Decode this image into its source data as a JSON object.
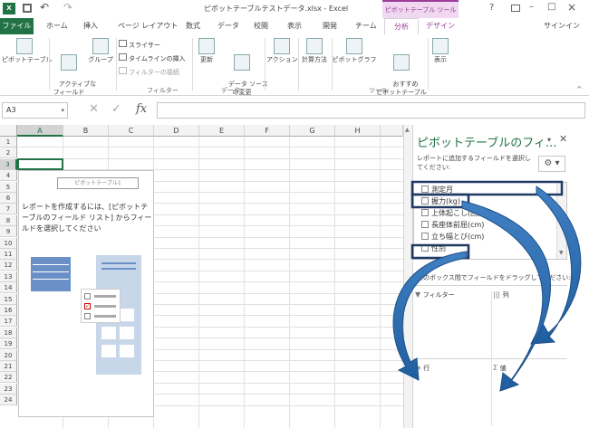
{
  "title": "ピボットテーブルテストデータ.xlsx - Excel",
  "context_tab": "ピボットテーブル ツール",
  "window_controls": {
    "help": "?",
    "minimize": "–",
    "restore": "□",
    "close": "×"
  },
  "signin": "サインイン",
  "tabs": [
    "ファイル",
    "ホーム",
    "挿入",
    "ページ レイアウト",
    "数式",
    "データ",
    "校閲",
    "表示",
    "開発",
    "チーム",
    "分析",
    "デザイン"
  ],
  "ribbon": {
    "pivot_table": "ピボットテーブル",
    "active_field": "アクティブな\nフィールド",
    "group": "グループ",
    "slicer": "スライサー",
    "timeline": "タイムラインの挿入",
    "filter_conn": "フィルターの接続",
    "filter_group": "フィルター",
    "refresh": "更新",
    "change_source": "データ ソース\nの変更",
    "data_group": "データ",
    "actions": "アクション",
    "calc": "計算方法",
    "pivot_chart": "ピボットグラフ",
    "recommended": "おすすめ\nピボットテーブル",
    "tools_group": "ツール",
    "show": "表示"
  },
  "namebox": "A3",
  "fx": "fx",
  "columns": [
    "A",
    "B",
    "C",
    "D",
    "E",
    "F",
    "G",
    "H"
  ],
  "rows": [
    "1",
    "2",
    "3",
    "4",
    "5",
    "6",
    "7",
    "8",
    "9",
    "10",
    "11",
    "12",
    "13",
    "14",
    "15",
    "16",
    "17",
    "18",
    "19",
    "20",
    "21",
    "22",
    "23",
    "24"
  ],
  "pivot_placeholder": {
    "label": "ピボットテーブル1",
    "instruction": "レポートを作成するには、[ピボットテーブルのフィールド リスト] からフィールドを選択してください"
  },
  "pane": {
    "title": "ピボットテーブルのフィ...",
    "subtitle": "レポートに追加するフィールドを選択してください:",
    "fields": [
      "測定月",
      "握力(kg)",
      "上体起こし(回)",
      "長座体前屈(cm)",
      "立ち幅とび(cm)",
      "性別"
    ],
    "drag_hint": "次のボックス間でフィールドをドラッグしてください:",
    "filter": "フィルター",
    "columns": "列",
    "rows": "行",
    "values": "値"
  },
  "colors": {
    "excel_green": "#217346",
    "context_purple": "#9a3d9a",
    "arrow_blue": "#1f5fa0",
    "box_navy": "#1f3864"
  }
}
